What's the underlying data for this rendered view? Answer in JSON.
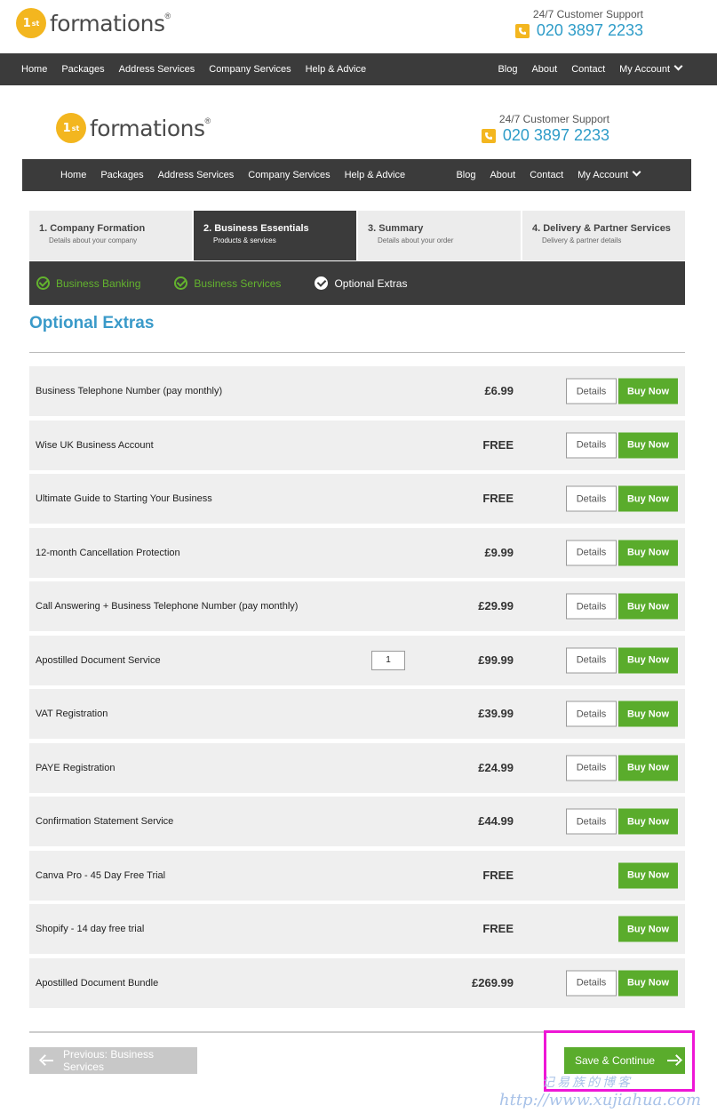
{
  "brand": {
    "logo_mark": "1",
    "logo_sup": "st",
    "logo_word": "formations",
    "reg": "®"
  },
  "support": {
    "label": "24/7 Customer Support",
    "phone": "020 3897 2233"
  },
  "nav": {
    "left": [
      "Home",
      "Packages",
      "Address Services",
      "Company Services",
      "Help & Advice"
    ],
    "right": [
      "Blog",
      "About",
      "Contact",
      "My Account"
    ]
  },
  "steps": [
    {
      "title": "1. Company Formation",
      "sub": "Details about your company"
    },
    {
      "title": "2. Business Essentials",
      "sub": "Products & services"
    },
    {
      "title": "3. Summary",
      "sub": "Details about your order"
    },
    {
      "title": "4. Delivery & Partner Services",
      "sub": "Delivery & partner details"
    }
  ],
  "substeps": [
    "Business Banking",
    "Business Services",
    "Optional Extras"
  ],
  "section_title": "Optional Extras",
  "labels": {
    "details": "Details",
    "buy": "Buy Now"
  },
  "products": [
    {
      "name": "Business Telephone Number (pay monthly)",
      "price": "£6.99"
    },
    {
      "name": "Wise UK Business Account",
      "price": "FREE"
    },
    {
      "name": "Ultimate Guide to Starting Your Business",
      "price": "FREE"
    },
    {
      "name": "12-month Cancellation Protection",
      "price": "£9.99"
    },
    {
      "name": "Call Answering + Business Telephone Number (pay monthly)",
      "price": "£29.99"
    },
    {
      "name": "Apostilled Document Service",
      "price": "£99.99",
      "qty": "1"
    },
    {
      "name": "VAT Registration",
      "price": "£39.99"
    },
    {
      "name": "PAYE Registration",
      "price": "£24.99"
    },
    {
      "name": "Confirmation Statement Service",
      "price": "£44.99"
    },
    {
      "name": "Canva Pro - 45 Day Free Trial",
      "price": "FREE"
    },
    {
      "name": "Shopify - 14 day free trial",
      "price": "FREE"
    },
    {
      "name": "Apostilled Document Bundle",
      "price": "£269.99"
    }
  ],
  "footer": {
    "prev": "Previous: Business Services",
    "save": "Save & Continue"
  },
  "watermark": {
    "cn": "记易族的博客",
    "url": "http://www.xujiahua.com"
  },
  "colors": {
    "accent_blue": "#3a9ac9",
    "green": "#5aac2c",
    "nav_bg": "#3b3b3b",
    "logo_yellow": "#f3b61f",
    "highlight": "#ee16d6"
  }
}
